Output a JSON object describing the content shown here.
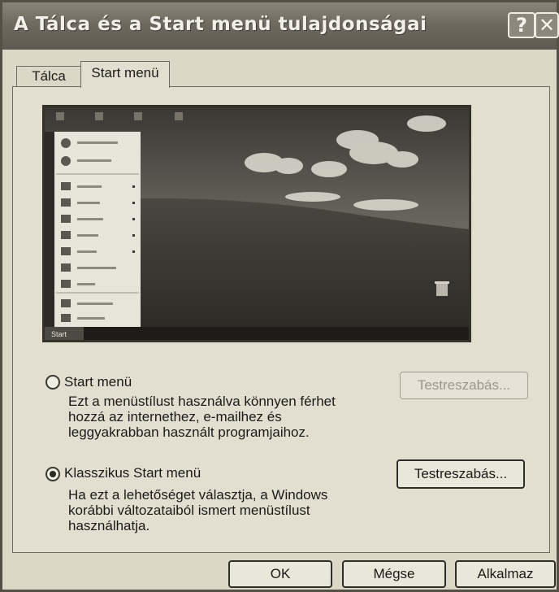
{
  "window": {
    "title": "A Tálca és a Start menü tulajdonságai",
    "help_button": "?",
    "close_button": "✕"
  },
  "tabs": [
    {
      "label": "Tálca",
      "selected": false
    },
    {
      "label": "Start menü",
      "selected": true
    }
  ],
  "options": {
    "start_menu": {
      "label": "Start menü",
      "selected": false,
      "description": [
        "Ezt a menüstílust használva könnyen férhet",
        "hozzá az internethez, e-mailhez és",
        "leggyakrabban használt programjaihoz."
      ],
      "customize_label": "Testreszabás...",
      "customize_enabled": false
    },
    "classic_menu": {
      "label": "Klasszikus Start menü",
      "selected": true,
      "description": [
        "Ha ezt a lehetőséget választja, a Windows",
        "korábbi változataiból ismert menüstílust",
        "használhatja."
      ],
      "customize_label": "Testreszabás...",
      "customize_enabled": true
    }
  },
  "footer": {
    "ok_label": "OK",
    "cancel_label": "Mégse",
    "apply_label": "Alkalmaz"
  },
  "preview": {
    "taskbar_label": "Start"
  }
}
